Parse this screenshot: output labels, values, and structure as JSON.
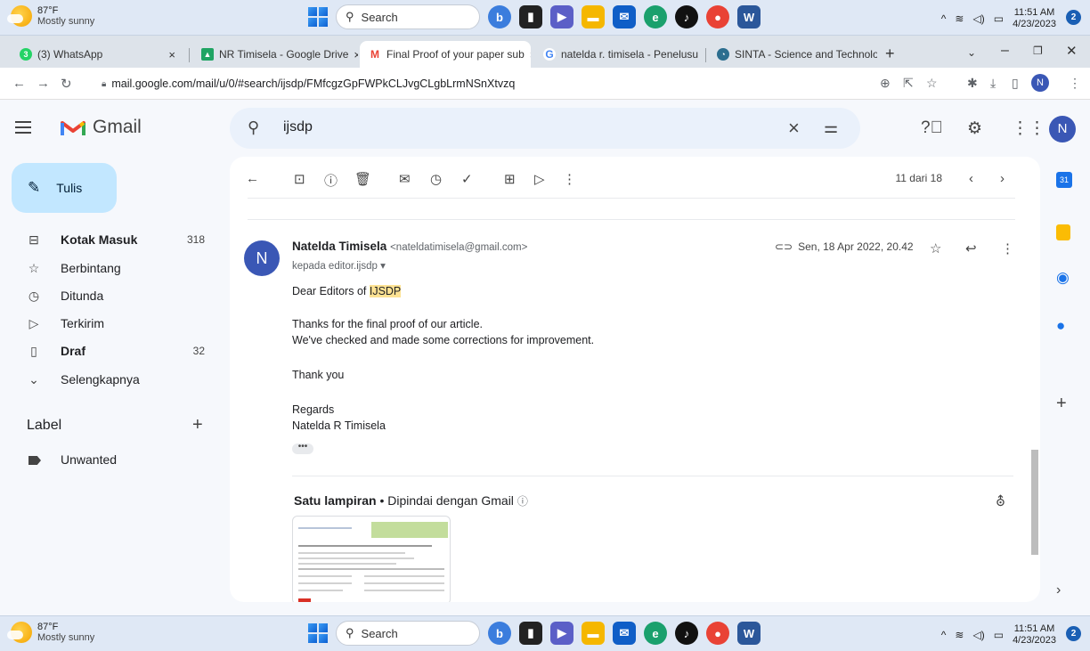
{
  "taskbar": {
    "temp": "87°F",
    "weather": "Mostly sunny",
    "search": "Search",
    "time": "11:51 AM",
    "date": "4/23/2023",
    "notif": "2"
  },
  "tabs": [
    {
      "label": "(3) WhatsApp",
      "x": "×"
    },
    {
      "label": "NR Timisela - Google Drive",
      "x": "×"
    },
    {
      "label": "Final Proof of your paper sub",
      "x": "×"
    },
    {
      "label": "natelda r. timisela - Penelusu",
      "x": "×"
    },
    {
      "label": "SINTA - Science and Technolo",
      "x": "×"
    }
  ],
  "browser": {
    "url": "mail.google.com/mail/u/0/#search/ijsdp/FMfcgzGpFWPkCLJvgCLgbLrmNSnXtvzq",
    "profile": "N"
  },
  "gmail": {
    "brand": "Gmail",
    "search_value": "ijsdp",
    "avatar": "N"
  },
  "sidebar": {
    "compose": "Tulis",
    "items": [
      {
        "label": "Kotak Masuk",
        "count": "318"
      },
      {
        "label": "Berbintang",
        "count": ""
      },
      {
        "label": "Ditunda",
        "count": ""
      },
      {
        "label": "Terkirim",
        "count": ""
      },
      {
        "label": "Draf",
        "count": "32"
      },
      {
        "label": "Selengkapnya",
        "count": ""
      }
    ],
    "labels_title": "Label",
    "labels": [
      {
        "label": "Unwanted"
      }
    ]
  },
  "message": {
    "pager": "11 dari 18",
    "sender_initial": "N",
    "sender_name": "Natelda Timisela",
    "sender_email": "<nateldatimisela@gmail.com>",
    "to": "kepada editor.ijsdp",
    "date": "Sen, 18 Apr 2022, 20.42",
    "greeting": "Dear Editors of ",
    "greeting_hl": "IJSDP",
    "line1": "Thanks for the final proof of our article.",
    "line2": "We've checked and made some corrections for improvement.",
    "thanks": "Thank you",
    "regards": "Regards",
    "signature": "Natelda R Timisela",
    "attach_count": "Satu lampiran",
    "attach_scan": " • Dipindai dengan Gmail "
  },
  "colors": {
    "accent": "#0b57d0",
    "compose": "#c2e7ff",
    "search": "#eaf1fb",
    "highlight": "#fde293"
  }
}
